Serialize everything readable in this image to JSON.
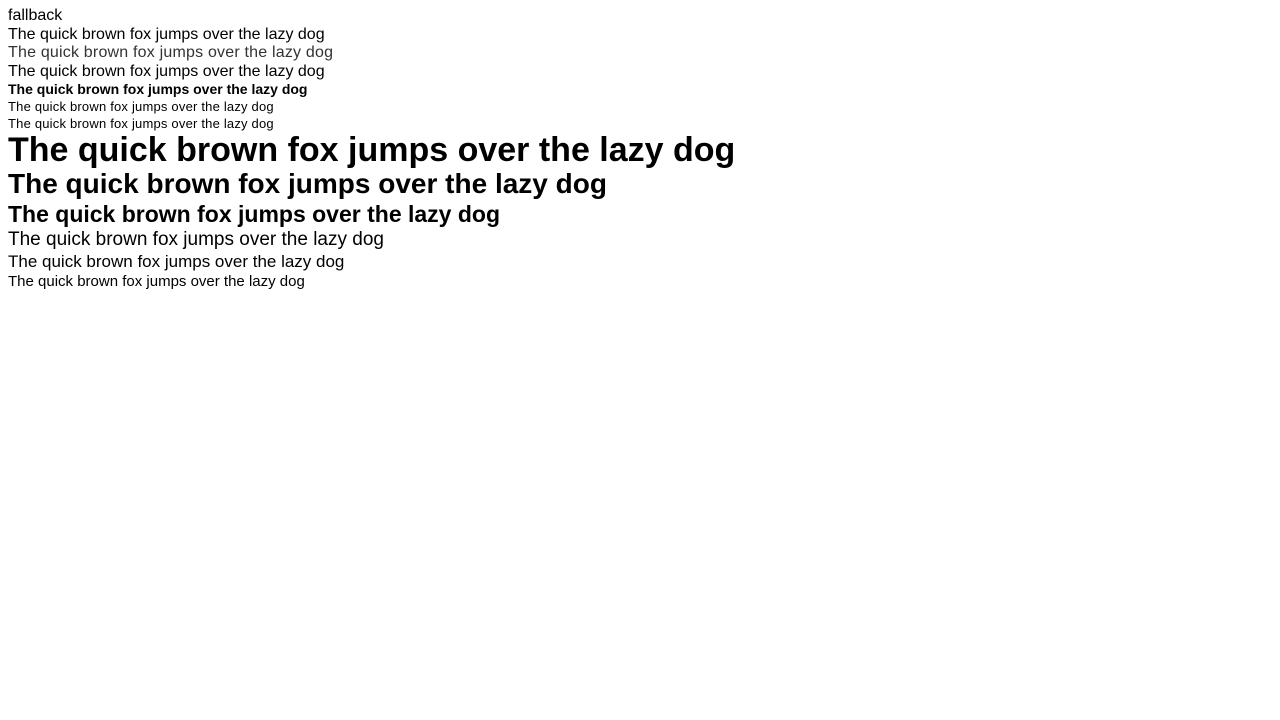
{
  "header": {
    "fallback_label": "fallback"
  },
  "samples": [
    "The quick brown fox jumps over the lazy dog",
    "The quick brown fox jumps over the lazy dog",
    "The quick brown fox jumps over the lazy dog",
    "The quick brown fox jumps over the lazy dog",
    "The quick brown fox jumps over the lazy dog",
    "The quick brown fox jumps over the lazy dog",
    "The quick brown fox jumps over the lazy dog",
    "The quick brown fox jumps over the lazy dog",
    "The quick brown fox jumps over the lazy dog",
    "The quick brown fox jumps over the lazy dog",
    "The quick brown fox jumps over the lazy dog",
    "The quick brown fox jumps over the lazy dog"
  ]
}
